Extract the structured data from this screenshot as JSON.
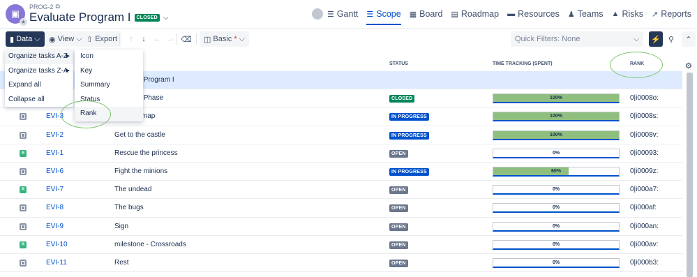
{
  "project": {
    "key": "PROG-2",
    "title": "Evaluate Program I",
    "status_badge": "CLOSED"
  },
  "nav": {
    "items": [
      {
        "label": "Gantt",
        "icon": "gantt-icon",
        "active": false
      },
      {
        "label": "Scope",
        "icon": "list-icon",
        "active": true
      },
      {
        "label": "Board",
        "icon": "board-icon",
        "active": false
      },
      {
        "label": "Roadmap",
        "icon": "roadmap-icon",
        "active": false
      },
      {
        "label": "Resources",
        "icon": "resources-icon",
        "active": false
      },
      {
        "label": "Teams",
        "icon": "teams-icon",
        "active": false
      },
      {
        "label": "Risks",
        "icon": "risks-icon",
        "active": false
      },
      {
        "label": "Reports",
        "icon": "reports-icon",
        "active": false
      }
    ]
  },
  "toolbar": {
    "data_label": "Data",
    "view_label": "View",
    "export_label": "Export",
    "basic_label": "Basic",
    "basic_required": "*",
    "quick_filters_placeholder": "Quick Filters: None"
  },
  "table": {
    "headers": {
      "status": "STATUS",
      "time_tracking": "TIME TRACKING (SPENT)",
      "rank": "RANK"
    },
    "program_row_summary": "Evaluate Program I",
    "rows": [
      {
        "key": "",
        "summary": "Evaluate Phase",
        "status": "CLOSED",
        "status_kind": "closed",
        "progress": "100%",
        "progress_value": 1.0,
        "rank": "0|i0008o:",
        "type": "task"
      },
      {
        "key": "EVI-3",
        "summary": "Find the map",
        "status": "IN PROGRESS",
        "status_kind": "progress",
        "progress": "100%",
        "progress_value": 1.0,
        "rank": "0|i0008s:",
        "type": "task"
      },
      {
        "key": "EVI-2",
        "summary": "Get to the castle",
        "status": "IN PROGRESS",
        "status_kind": "progress",
        "progress": "100%",
        "progress_value": 1.0,
        "rank": "0|i0008v:",
        "type": "task"
      },
      {
        "key": "EVI-1",
        "summary": "Rescue the princess",
        "status": "OPEN",
        "status_kind": "open",
        "progress": "0%",
        "progress_value": 0.0,
        "rank": "0|i00093:",
        "type": "milestone"
      },
      {
        "key": "EVI-6",
        "summary": "Fight the minions",
        "status": "IN PROGRESS",
        "status_kind": "progress",
        "progress": "60%",
        "progress_value": 0.6,
        "rank": "0|i0009z:",
        "type": "task"
      },
      {
        "key": "EVI-7",
        "summary": "The undead",
        "status": "OPEN",
        "status_kind": "open",
        "progress": "0%",
        "progress_value": 0.0,
        "rank": "0|i000a7:",
        "type": "milestone"
      },
      {
        "key": "EVI-8",
        "summary": "The bugs",
        "status": "OPEN",
        "status_kind": "open",
        "progress": "0%",
        "progress_value": 0.0,
        "rank": "0|i000af:",
        "type": "task"
      },
      {
        "key": "EVI-9",
        "summary": "Sign",
        "status": "OPEN",
        "status_kind": "open",
        "progress": "0%",
        "progress_value": 0.0,
        "rank": "0|i000an:",
        "type": "task"
      },
      {
        "key": "EVI-10",
        "summary": "milestone - Crossroads",
        "status": "OPEN",
        "status_kind": "open",
        "progress": "0%",
        "progress_value": 0.0,
        "rank": "0|i000av:",
        "type": "milestone"
      },
      {
        "key": "EVI-11",
        "summary": "Rest",
        "status": "OPEN",
        "status_kind": "open",
        "progress": "0%",
        "progress_value": 0.0,
        "rank": "0|i000b3:",
        "type": "task"
      }
    ]
  },
  "data_menu": {
    "items": [
      {
        "label": "Organize tasks A-Z",
        "submenu": true
      },
      {
        "label": "Organize tasks Z-A",
        "submenu": true
      },
      {
        "label": "Expand all",
        "submenu": false
      },
      {
        "label": "Collapse all",
        "submenu": false
      }
    ]
  },
  "sort_submenu": {
    "items": [
      "Icon",
      "Key",
      "Summary",
      "Status",
      "Rank"
    ]
  },
  "colors": {
    "accent": "#0052cc",
    "toolbar_dark": "#253858",
    "closed": "#00875a",
    "open": "#6b778c",
    "progress_fill": "#8fbf7f",
    "annotation": "#7cc56b"
  }
}
